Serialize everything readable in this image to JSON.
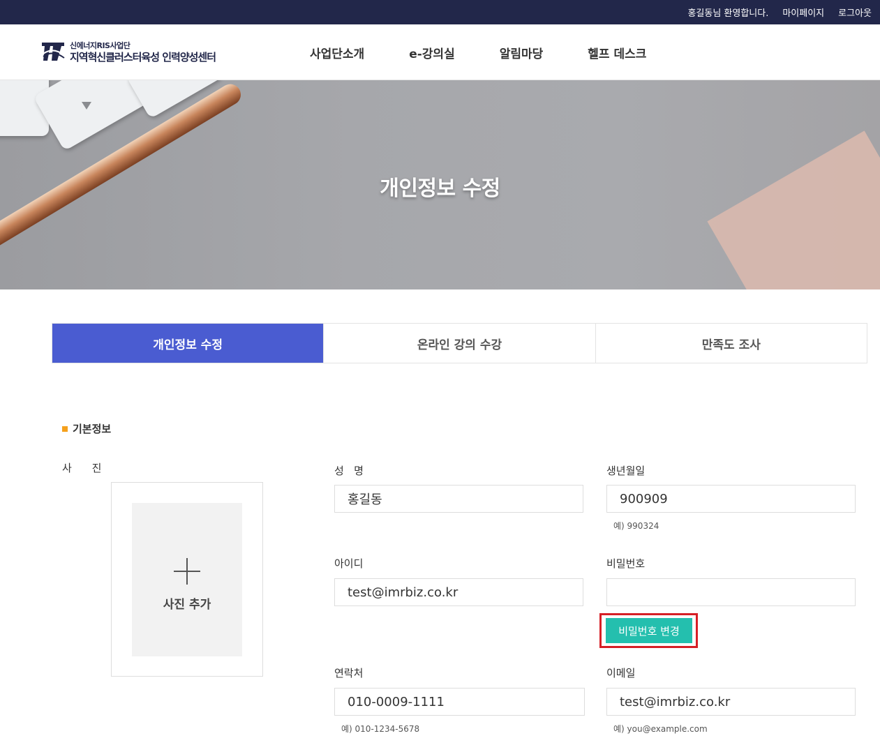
{
  "topbar": {
    "welcome": "홍길동님 환영합니다.",
    "mypage": "마이페이지",
    "logout": "로그아웃"
  },
  "header": {
    "logo_line1": "신에너지RIS사업단",
    "logo_line2": "지역혁신클러스터육성 인력양성센터",
    "nav": [
      "사업단소개",
      "e-강의실",
      "알림마당",
      "헬프 데스크"
    ]
  },
  "hero": {
    "title": "개인정보 수정"
  },
  "tabs": [
    {
      "label": "개인정보 수정",
      "active": true
    },
    {
      "label": "온라인 강의 수강",
      "active": false
    },
    {
      "label": "만족도 조사",
      "active": false
    }
  ],
  "form": {
    "section_title": "기본정보",
    "photo_label": "사 진",
    "photo_add_label": "사진 추가",
    "name_label": "성   명",
    "name_value": "홍길동",
    "birth_label": "생년월일",
    "birth_value": "900909",
    "birth_hint": "예) 990324",
    "id_label": "아이디",
    "id_value": "test@imrbiz.co.kr",
    "password_label": "비밀번호",
    "password_value": "",
    "password_change_button": "비밀번호 변경",
    "phone_label": "연락처",
    "phone_value": "010-0009-1111",
    "phone_hint": "예) 010-1234-5678",
    "email_label": "이메일",
    "email_value": "test@imrbiz.co.kr",
    "email_hint": "예) you@example.com"
  },
  "colors": {
    "topbar_bg": "#22274a",
    "tab_active": "#4a5cd1",
    "button_teal": "#24bfae",
    "highlight_red": "#d61f26",
    "bullet_orange": "#f5a11d"
  }
}
